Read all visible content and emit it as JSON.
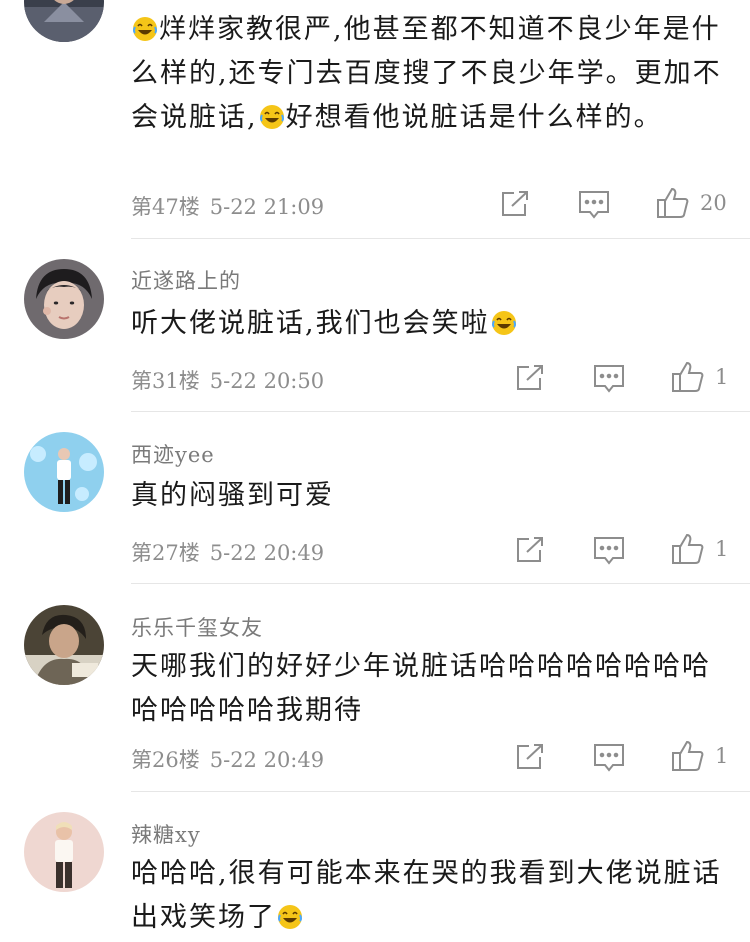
{
  "comments": [
    {
      "username": "",
      "text_parts": [
        {
          "type": "emoji",
          "name": "laughing-tears-emoji"
        },
        {
          "type": "text",
          "value": "烊烊家教很严,他甚至都不知道不良少年是什么样的,还专门去百度搜了不良少年学。更加不会说脏话,"
        },
        {
          "type": "emoji",
          "name": "laughing-tears-emoji"
        },
        {
          "type": "text",
          "value": "好想看他说脏话是什么样的。"
        }
      ],
      "floor": "第47楼",
      "time": "5-22 21:09",
      "likes": "20"
    },
    {
      "username": "近遂路上的",
      "text": "听大佬说脏话,我们也会笑啦",
      "floor": "第31楼",
      "time": "5-22 20:50",
      "likes": "1"
    },
    {
      "username": "西迹yee",
      "text": "真的闷骚到可爱",
      "floor": "第27楼",
      "time": "5-22 20:49",
      "likes": "1"
    },
    {
      "username": "乐乐千玺女友",
      "text": "天哪我们的好好少年说脏话哈哈哈哈哈哈哈哈哈哈哈哈哈我期待",
      "floor": "第26楼",
      "time": "5-22 20:49",
      "likes": "1"
    },
    {
      "username": "辣糖xy",
      "text": "哈哈哈,很有可能本来在哭的我看到大佬说脏话出戏笑场了",
      "floor": "",
      "time": "",
      "likes": ""
    }
  ],
  "icons": {
    "share": "share-icon",
    "reply": "reply-icon",
    "like": "thumbs-up-icon"
  },
  "colors": {
    "text": "#1a1a1a",
    "meta": "#8d8d8d",
    "divider": "#e6e6e6",
    "emoji": "#f5c518"
  }
}
